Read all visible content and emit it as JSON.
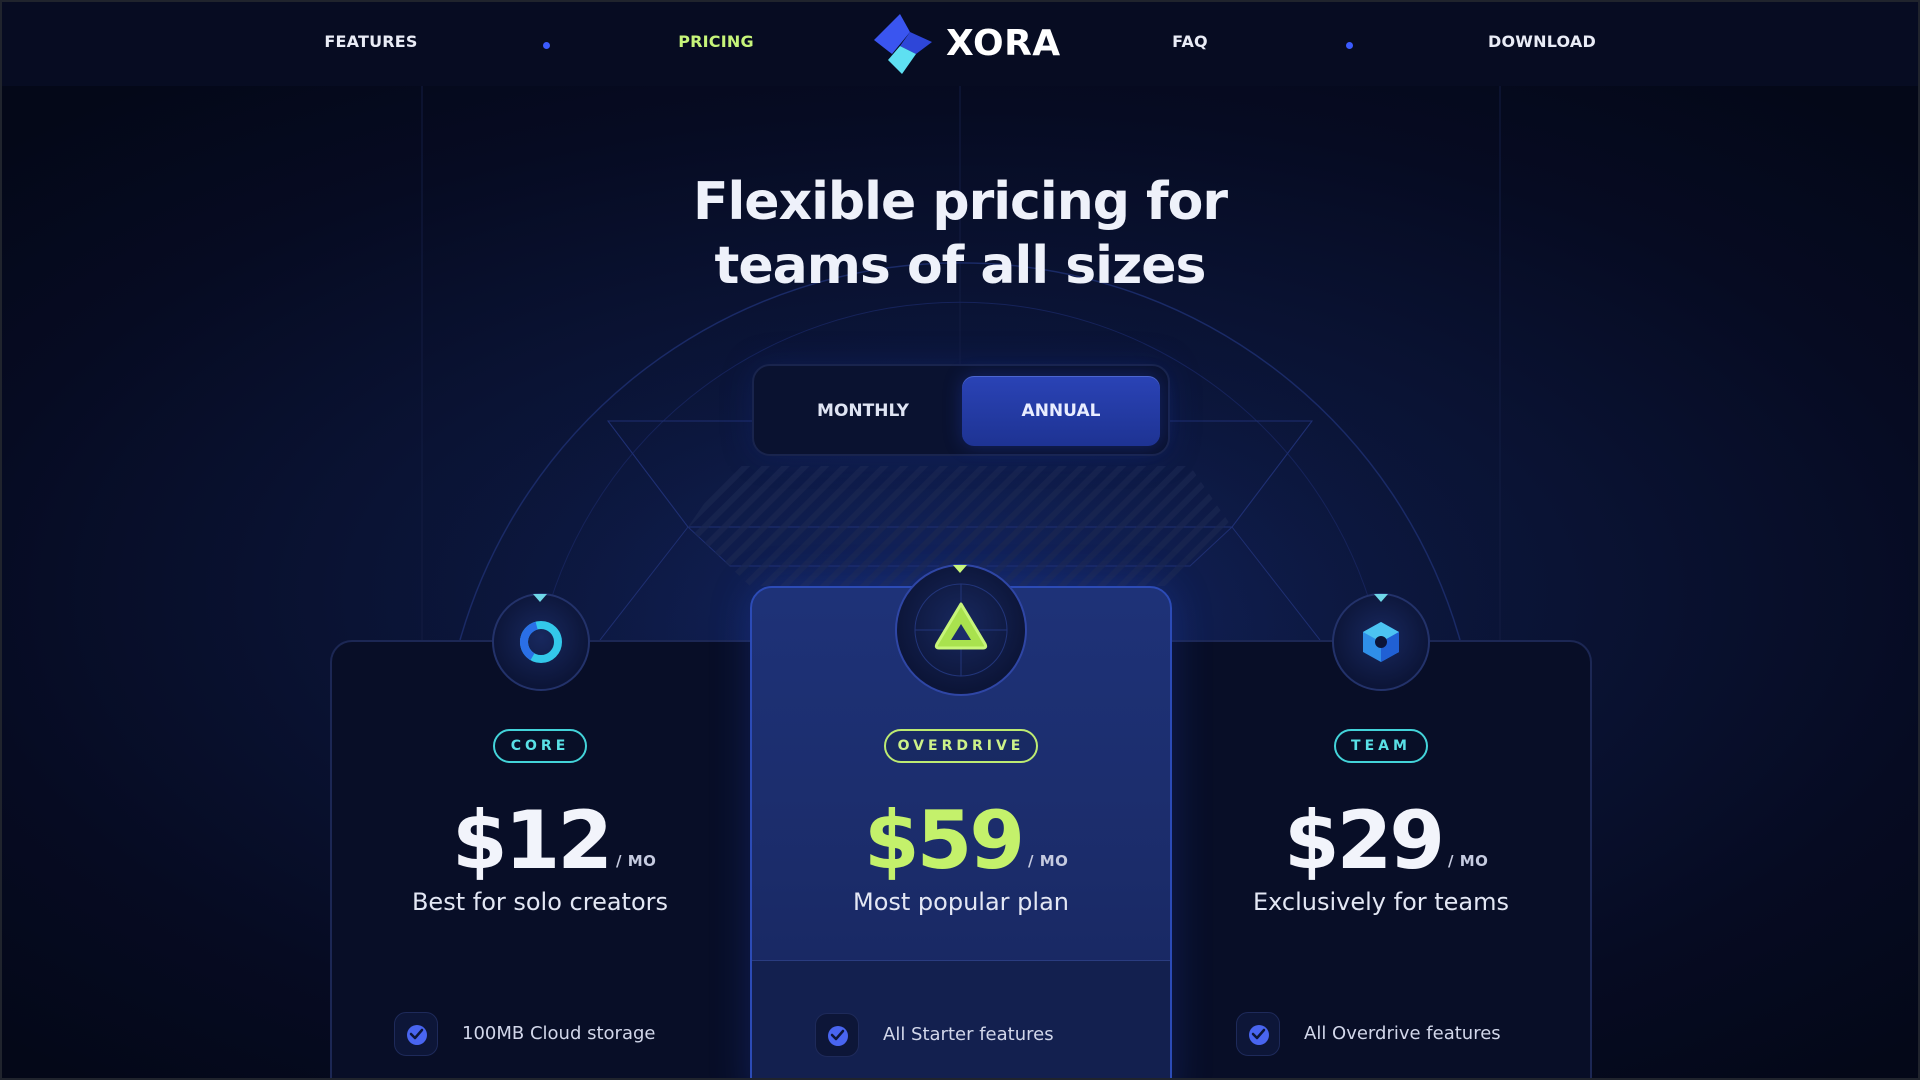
{
  "nav": {
    "brand": "XORA",
    "links": [
      {
        "label": "FEATURES",
        "active": false
      },
      {
        "label": "PRICING",
        "active": true
      },
      {
        "label": "FAQ",
        "active": false
      },
      {
        "label": "DOWNLOAD",
        "active": false
      }
    ]
  },
  "hero": {
    "title_line1": "Flexible pricing for",
    "title_line2": "teams of all sizes"
  },
  "billing_toggle": {
    "options": [
      "MONTHLY",
      "ANNUAL"
    ],
    "selected": "ANNUAL"
  },
  "plans": [
    {
      "badge": "CORE",
      "price": "$12",
      "period": "/ MO",
      "tagline": "Best for solo creators",
      "features": [
        "100MB Cloud storage"
      ],
      "emblem_icon": "ring-icon"
    },
    {
      "badge": "OVERDRIVE",
      "price": "$59",
      "period": "/ MO",
      "tagline": "Most popular plan",
      "features": [
        "All Starter features"
      ],
      "emblem_icon": "triangle-icon",
      "featured": true
    },
    {
      "badge": "TEAM",
      "price": "$29",
      "period": "/ MO",
      "tagline": "Exclusively for teams",
      "features": [
        "All Overdrive features"
      ],
      "emblem_icon": "hexagon-icon"
    }
  ],
  "colors": {
    "background": "#060b22",
    "accent_green": "#c4f16b",
    "accent_cyan": "#43d3d9",
    "accent_blue": "#2a43b6"
  }
}
